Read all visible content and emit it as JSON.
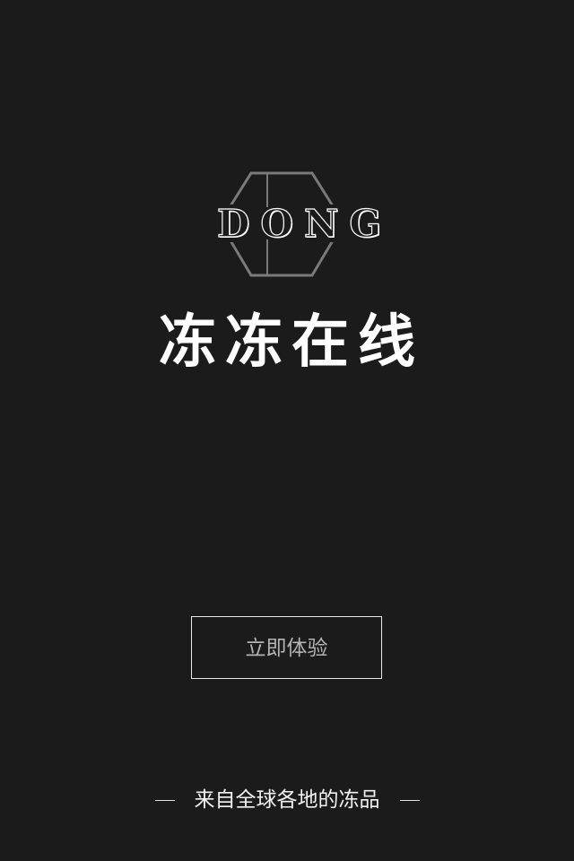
{
  "splash": {
    "logo_word": "DONG",
    "app_title": "冻冻在线",
    "start_button_label": "立即体验",
    "tagline": "来自全球各地的冻品"
  },
  "colors": {
    "background": "#1b1b1b",
    "text": "#ffffff",
    "button_border": "#e9e9e9",
    "button_text": "#b3b3b3",
    "logo_outline": "#7a7a7a"
  }
}
